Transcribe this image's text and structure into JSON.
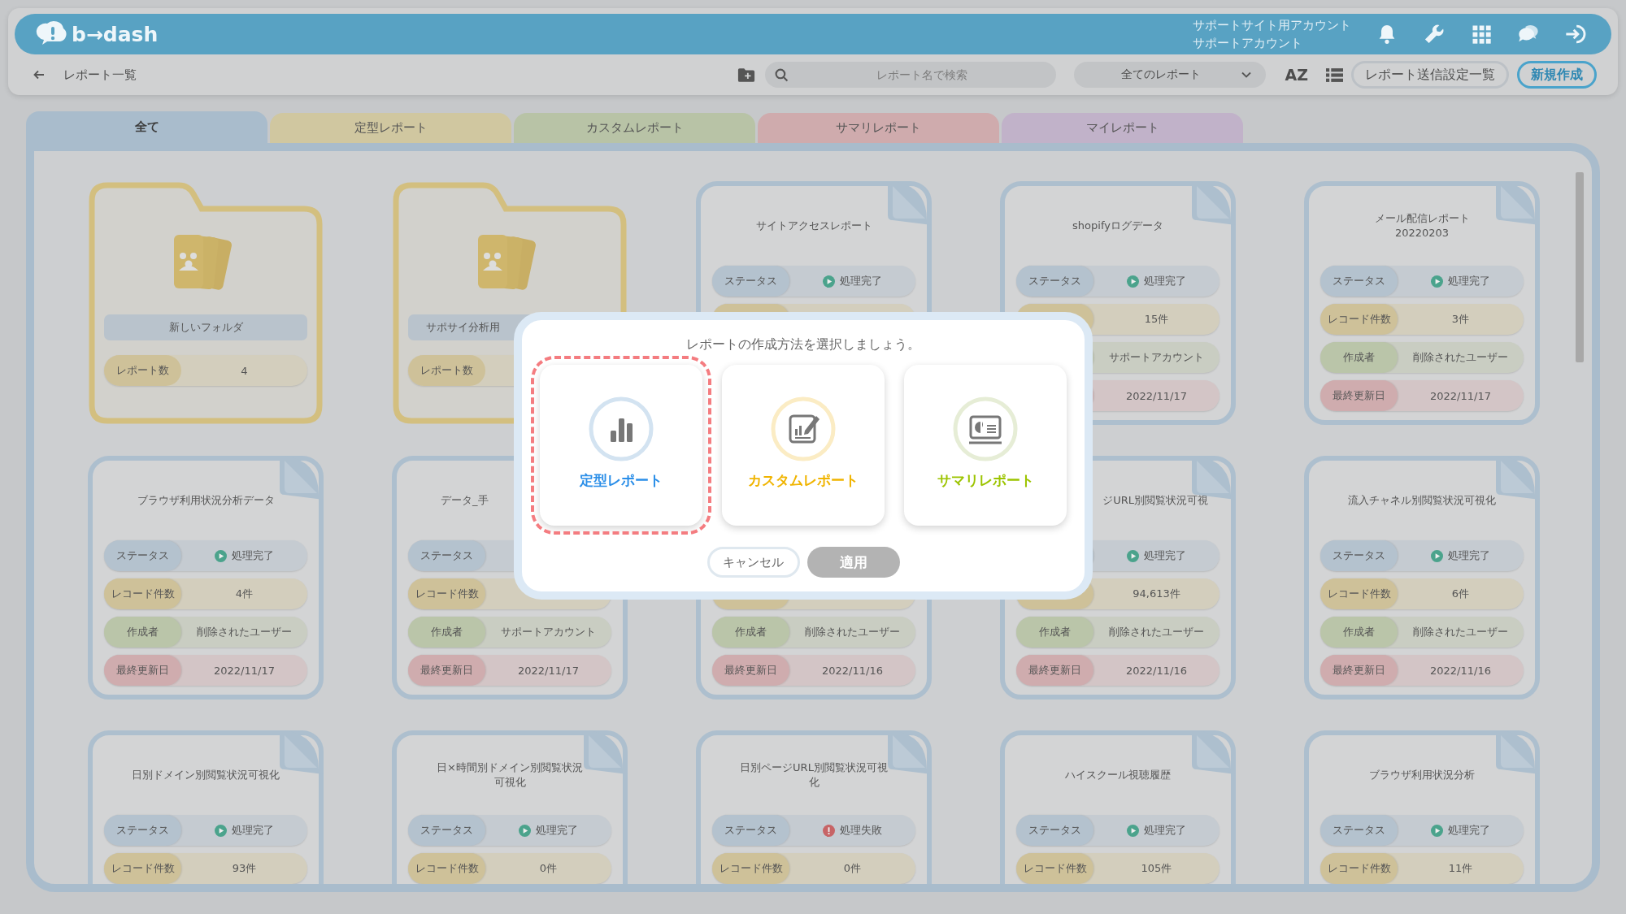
{
  "header": {
    "logo": "b→dash",
    "account_lines": [
      "サポートサイト用アカウント",
      "サポートアカウント"
    ]
  },
  "toolbar": {
    "title": "レポート一覧",
    "search": {
      "placeholder": "レポート名で検索"
    },
    "filter": {
      "value": "全てのレポート"
    },
    "sort_label": "AZ",
    "buttons": [
      {
        "label": "レポート送信設定一覧",
        "kind": "outline"
      },
      {
        "label": "新規作成",
        "kind": "primary"
      }
    ]
  },
  "tabs": [
    {
      "label": "全て",
      "color": "#a9bccc",
      "selected": true
    },
    {
      "label": "定型レポート",
      "color": "#d0c7a0",
      "selected": false
    },
    {
      "label": "カスタムレポート",
      "color": "#b8c3a6",
      "selected": false
    },
    {
      "label": "サマリレポート",
      "color": "#cfabad",
      "selected": false
    },
    {
      "label": "マイレポート",
      "color": "#c1b2c9",
      "selected": false
    }
  ],
  "cards": [
    {
      "kind": "folder",
      "name": "新しいフォルダ",
      "count_label": "レポート数",
      "count": "4"
    },
    {
      "kind": "folder",
      "name": "サポサイ分析用",
      "cut_right": true,
      "count_label": "レポート数"
    },
    {
      "kind": "report",
      "title": "サイトアクセスレポート",
      "rows": [
        {
          "kind": "status",
          "label": "ステータス",
          "value": "処理完了",
          "failed": false
        }
      ]
    },
    {
      "kind": "report",
      "title": "shopifyログデータ",
      "rows": [
        {
          "kind": "status",
          "label": "ステータス",
          "value": "処理完了",
          "failed": false
        },
        {
          "kind": "records",
          "value": "15件"
        },
        {
          "kind": "creator",
          "value": "サポートアカウント"
        },
        {
          "kind": "updated",
          "value": "2022/11/17"
        }
      ]
    },
    {
      "kind": "report",
      "title": "メール配信レポート20220203",
      "rows": [
        {
          "kind": "status",
          "label": "ステータス",
          "value": "処理完了",
          "failed": false
        },
        {
          "kind": "records",
          "label": "レコード件数",
          "value": "3件"
        },
        {
          "kind": "creator",
          "label": "作成者",
          "value": "削除されたユーザー"
        },
        {
          "kind": "updated",
          "label": "最終更新日",
          "value": "2022/11/17"
        }
      ]
    },
    {
      "kind": "report",
      "title": "ブラウザ利用状況分析データ",
      "rows": [
        {
          "kind": "status",
          "label": "ステータス",
          "value": "処理完了",
          "failed": false
        },
        {
          "kind": "records",
          "label": "レコード件数",
          "value": "4件"
        },
        {
          "kind": "creator",
          "label": "作成者",
          "value": "削除されたユーザー"
        },
        {
          "kind": "updated",
          "label": "最終更新日",
          "value": "2022/11/17"
        }
      ]
    },
    {
      "kind": "report",
      "title": "データ_手",
      "cut_right": true,
      "rows": [
        {
          "kind": "status",
          "label": "ステータス"
        },
        {
          "kind": "records",
          "label": "レコード件数"
        },
        {
          "kind": "creator",
          "label": "作成者",
          "value": "サポートアカウント"
        },
        {
          "kind": "updated",
          "label": "最終更新日",
          "value": "2022/11/17"
        }
      ]
    },
    {
      "kind": "report",
      "rows": [
        {
          "kind": "creator",
          "label": "作成者",
          "value": "削除されたユーザー"
        },
        {
          "kind": "updated",
          "label": "最終更新日",
          "value": "2022/11/16"
        }
      ]
    },
    {
      "kind": "report",
      "title": "ジURL別閲覧状況可視",
      "cut_left": true,
      "rows": [
        {
          "kind": "status",
          "value": "処理完了",
          "failed": false
        },
        {
          "kind": "records",
          "value": "94,613件"
        },
        {
          "kind": "creator",
          "label": "作成者",
          "value": "削除されたユーザー"
        },
        {
          "kind": "updated",
          "label": "最終更新日",
          "value": "2022/11/16"
        }
      ]
    },
    {
      "kind": "report",
      "title": "流入チャネル別閲覧状況可視化",
      "rows": [
        {
          "kind": "status",
          "label": "ステータス",
          "value": "処理完了",
          "failed": false
        },
        {
          "kind": "records",
          "label": "レコード件数",
          "value": "6件"
        },
        {
          "kind": "creator",
          "label": "作成者",
          "value": "削除されたユーザー"
        },
        {
          "kind": "updated",
          "label": "最終更新日",
          "value": "2022/11/16"
        }
      ]
    },
    {
      "kind": "report",
      "title": "日別ドメイン別閲覧状況可視化",
      "rows": [
        {
          "kind": "status",
          "label": "ステータス",
          "value": "処理完了",
          "failed": false
        },
        {
          "kind": "records",
          "label": "レコード件数",
          "value": "93件"
        }
      ]
    },
    {
      "kind": "report",
      "title": "日×時間別ドメイン別閲覧状況可視化",
      "rows": [
        {
          "kind": "status",
          "label": "ステータス",
          "value": "処理完了",
          "failed": false
        },
        {
          "kind": "records",
          "label": "レコード件数",
          "value": "0件"
        }
      ]
    },
    {
      "kind": "report",
      "title": "日別ページURL別閲覧状況可視化",
      "rows": [
        {
          "kind": "status",
          "label": "ステータス",
          "value": "処理失敗",
          "failed": true
        },
        {
          "kind": "records",
          "label": "レコード件数",
          "value": "0件"
        }
      ]
    },
    {
      "kind": "report",
      "title": "ハイスクール視聴履歴",
      "rows": [
        {
          "kind": "status",
          "label": "ステータス",
          "value": "処理完了",
          "failed": false
        },
        {
          "kind": "records",
          "label": "レコード件数",
          "value": "105件"
        }
      ]
    },
    {
      "kind": "report",
      "title": "ブラウザ利用状況分析",
      "rows": [
        {
          "kind": "status",
          "label": "ステータス",
          "value": "処理完了",
          "failed": false
        },
        {
          "kind": "records",
          "label": "レコード件数",
          "value": "11件"
        }
      ]
    }
  ],
  "modal": {
    "title": "レポートの作成方法を選択しましょう。",
    "options": [
      {
        "label": "定型レポート",
        "kind": "standard",
        "color": "#2a8ee8",
        "selected": true
      },
      {
        "label": "カスタムレポート",
        "kind": "custom",
        "color": "#f0b400",
        "selected": false
      },
      {
        "label": "サマリレポート",
        "kind": "summary",
        "color": "#9cc400",
        "selected": false
      }
    ],
    "buttons": [
      {
        "label": "キャンセル",
        "disabled": false
      },
      {
        "label": "適用",
        "disabled": true
      }
    ]
  }
}
